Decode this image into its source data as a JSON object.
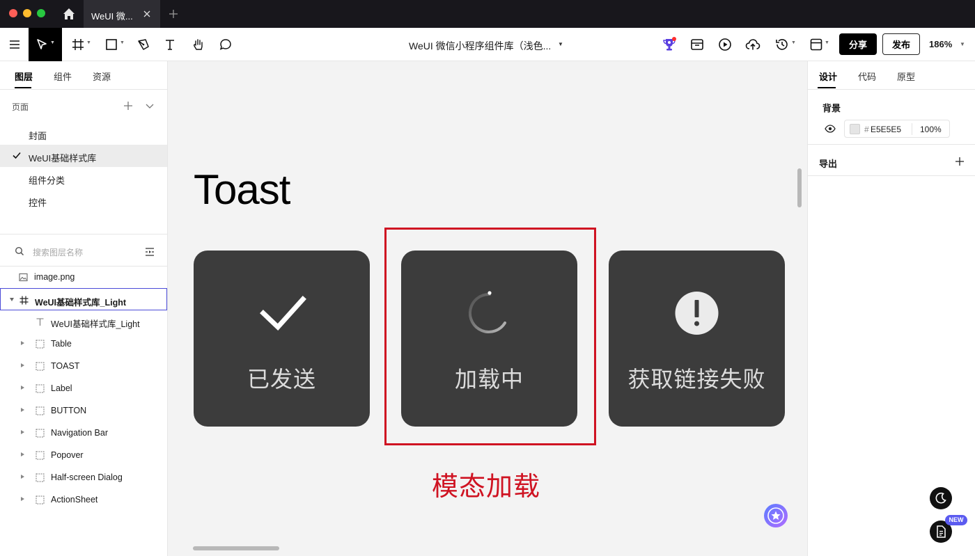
{
  "window": {
    "tab_title": "WeUI 微...",
    "home_icon": "home-icon",
    "new_tab_icon": "plus-icon"
  },
  "toolbar": {
    "file_title": "WeUI 微信小程序组件库（浅色...",
    "share_label": "分享",
    "publish_label": "发布",
    "zoom": "186%",
    "tools": [
      "menu-icon",
      "move-tool-icon",
      "frame-tool-icon",
      "rectangle-tool-icon",
      "pen-tool-icon",
      "text-tool-icon",
      "hand-tool-icon",
      "comment-tool-icon"
    ],
    "right_icons": [
      "trophy-icon",
      "archive-icon",
      "play-icon",
      "upload-cloud-icon",
      "history-icon",
      "layout-icon"
    ]
  },
  "left_panel": {
    "tabs": [
      "图层",
      "组件",
      "资源"
    ],
    "active_tab": "图层",
    "pages_label": "页面",
    "pages": [
      {
        "label": "封面",
        "active": false
      },
      {
        "label": "WeUI基础样式库",
        "active": true
      },
      {
        "label": "组件分类",
        "active": false
      },
      {
        "label": "控件",
        "active": false
      }
    ],
    "search_placeholder": "搜索图层名称",
    "layers": [
      {
        "label": "image.png",
        "icon": "image-icon",
        "indent": 0,
        "expandable": false,
        "selected": false
      },
      {
        "label": "WeUI基础样式库_Light",
        "icon": "frame-icon",
        "indent": 0,
        "expandable": true,
        "expanded": true,
        "selected": true
      },
      {
        "label": "WeUI基础样式库_Light",
        "icon": "text-icon",
        "indent": 1,
        "expandable": false,
        "selected": false
      },
      {
        "label": "Table",
        "icon": "group-icon",
        "indent": 1,
        "expandable": true,
        "selected": false
      },
      {
        "label": "TOAST",
        "icon": "group-icon",
        "indent": 1,
        "expandable": true,
        "selected": false
      },
      {
        "label": "Label",
        "icon": "group-icon",
        "indent": 1,
        "expandable": true,
        "selected": false
      },
      {
        "label": "BUTTON",
        "icon": "group-icon",
        "indent": 1,
        "expandable": true,
        "selected": false
      },
      {
        "label": "Navigation Bar",
        "icon": "group-icon",
        "indent": 1,
        "expandable": true,
        "selected": false
      },
      {
        "label": "Popover",
        "icon": "group-icon",
        "indent": 1,
        "expandable": true,
        "selected": false
      },
      {
        "label": "Half-screen Dialog",
        "icon": "group-icon",
        "indent": 1,
        "expandable": true,
        "selected": false
      },
      {
        "label": "ActionSheet",
        "icon": "group-icon",
        "indent": 1,
        "expandable": true,
        "selected": false
      }
    ]
  },
  "canvas": {
    "heading": "Toast",
    "toasts": [
      {
        "caption": "已发送",
        "icon": "checkmark-icon"
      },
      {
        "caption": "加载中",
        "icon": "loading-spinner-icon"
      },
      {
        "caption": "获取链接失败",
        "icon": "warning-icon"
      }
    ],
    "annotation": "模态加载",
    "highlight_color": "#cf1322",
    "toast_bg": "#3c3c3c"
  },
  "right_panel": {
    "tabs": [
      "设计",
      "代码",
      "原型"
    ],
    "active_tab": "设计",
    "background_label": "背景",
    "background_hex": "E5E5E5",
    "background_opacity": "100",
    "opacity_unit": "%",
    "export_label": "导出",
    "new_badge": "NEW"
  }
}
